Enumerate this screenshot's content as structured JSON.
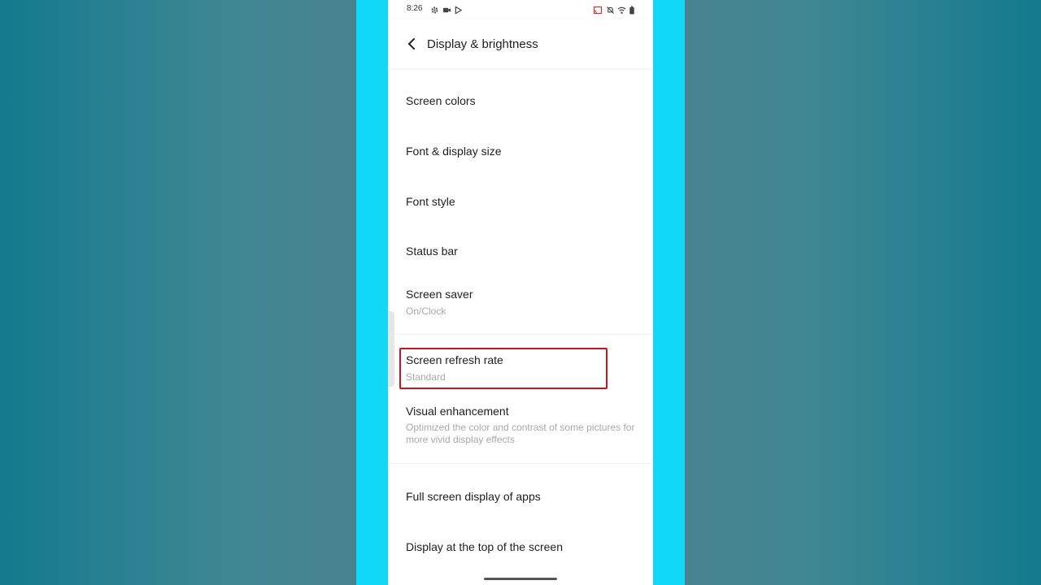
{
  "status_bar": {
    "time": "8:26",
    "left_icons": [
      "gear-icon",
      "video-camera-icon",
      "play-store-icon"
    ],
    "right_icons": [
      "cast-icon",
      "bell-off-icon",
      "wifi-icon",
      "battery-icon"
    ]
  },
  "header": {
    "title": "Display & brightness",
    "back_icon": "chevron-left-icon"
  },
  "items": [
    {
      "title": "Screen colors",
      "subtitle": ""
    },
    {
      "title": "Font & display size",
      "subtitle": ""
    },
    {
      "title": "Font style",
      "subtitle": ""
    },
    {
      "title": "Status bar",
      "subtitle": ""
    },
    {
      "title": "Screen saver",
      "subtitle": "On/Clock"
    },
    {
      "title": "Screen refresh rate",
      "subtitle": "Standard"
    },
    {
      "title": "Visual enhancement",
      "subtitle": "Optimized the color and contrast of some pictures for more vivid display effects"
    },
    {
      "title": "Full screen display of apps",
      "subtitle": ""
    },
    {
      "title": "Display at the top of the screen",
      "subtitle": ""
    }
  ],
  "colors": {
    "frame_accent": "#12d8f7",
    "highlight_border": "#d0121b",
    "subtitle_text": "#a8a8a8"
  }
}
